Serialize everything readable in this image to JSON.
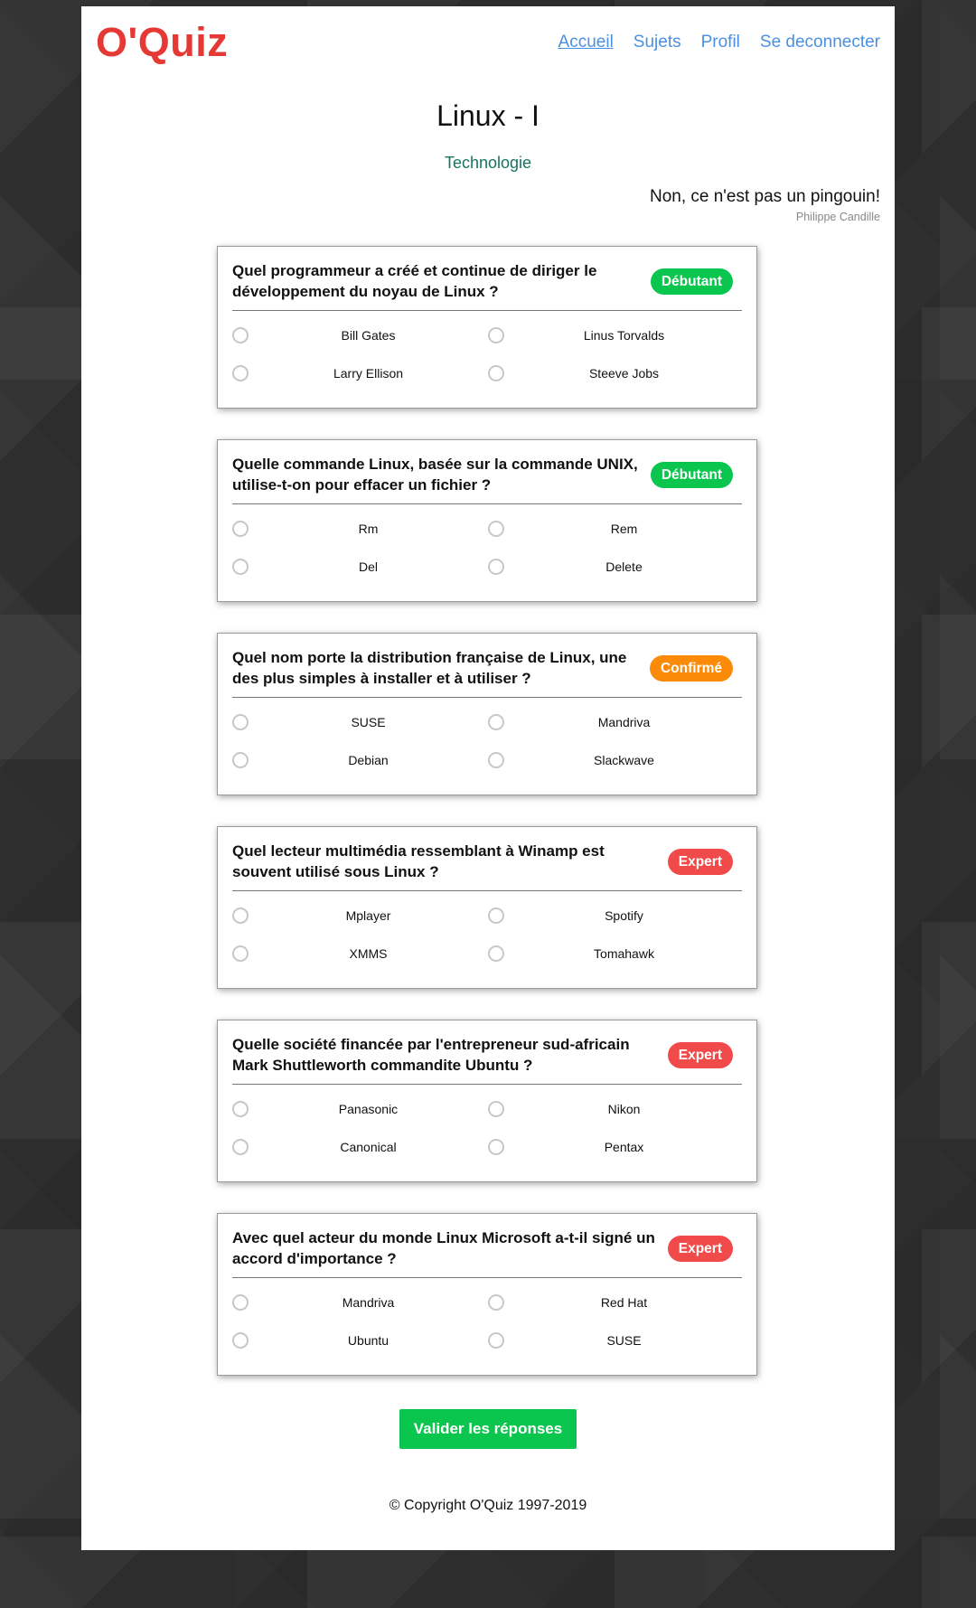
{
  "header": {
    "logo": "O'Quiz",
    "nav": [
      {
        "label": "Accueil",
        "active": true
      },
      {
        "label": "Sujets",
        "active": false
      },
      {
        "label": "Profil",
        "active": false
      },
      {
        "label": "Se deconnecter",
        "active": false
      }
    ]
  },
  "quiz": {
    "title": "Linux - I",
    "category": "Technologie",
    "description": "Non, ce n'est pas un pingouin!",
    "author": "Philippe Candille"
  },
  "questions": [
    {
      "text": "Quel programmeur a créé et continue de diriger le développement du noyau de Linux ?",
      "level": "Débutant",
      "answers": [
        "Bill Gates",
        "Linus Torvalds",
        "Larry Ellison",
        "Steeve Jobs"
      ]
    },
    {
      "text": "Quelle commande Linux, basée sur la commande UNIX, utilise-t-on pour effacer un fichier ?",
      "level": "Débutant",
      "answers": [
        "Rm",
        "Rem",
        "Del",
        "Delete"
      ]
    },
    {
      "text": "Quel nom porte la distribution française de Linux, une des plus simples à installer et à utiliser ?",
      "level": "Confirmé",
      "answers": [
        "SUSE",
        "Mandriva",
        "Debian",
        "Slackwave"
      ]
    },
    {
      "text": "Quel lecteur multimédia ressemblant à Winamp est souvent utilisé sous Linux ?",
      "level": "Expert",
      "answers": [
        "Mplayer",
        "Spotify",
        "XMMS",
        "Tomahawk"
      ]
    },
    {
      "text": "Quelle société financée par l'entrepreneur sud-africain Mark Shuttleworth commandite Ubuntu ?",
      "level": "Expert",
      "answers": [
        "Panasonic",
        "Nikon",
        "Canonical",
        "Pentax"
      ]
    },
    {
      "text": "Avec quel acteur du monde Linux Microsoft a-t-il signé un accord d'importance ?",
      "level": "Expert",
      "answers": [
        "Mandriva",
        "Red Hat",
        "Ubuntu",
        "SUSE"
      ]
    }
  ],
  "level_colors": {
    "Débutant": "#0bc64e",
    "Confirmé": "#fb8a08",
    "Expert": "#f04a4a"
  },
  "submit_label": "Valider les réponses",
  "footer": "© Copyright O'Quiz 1997-2019"
}
